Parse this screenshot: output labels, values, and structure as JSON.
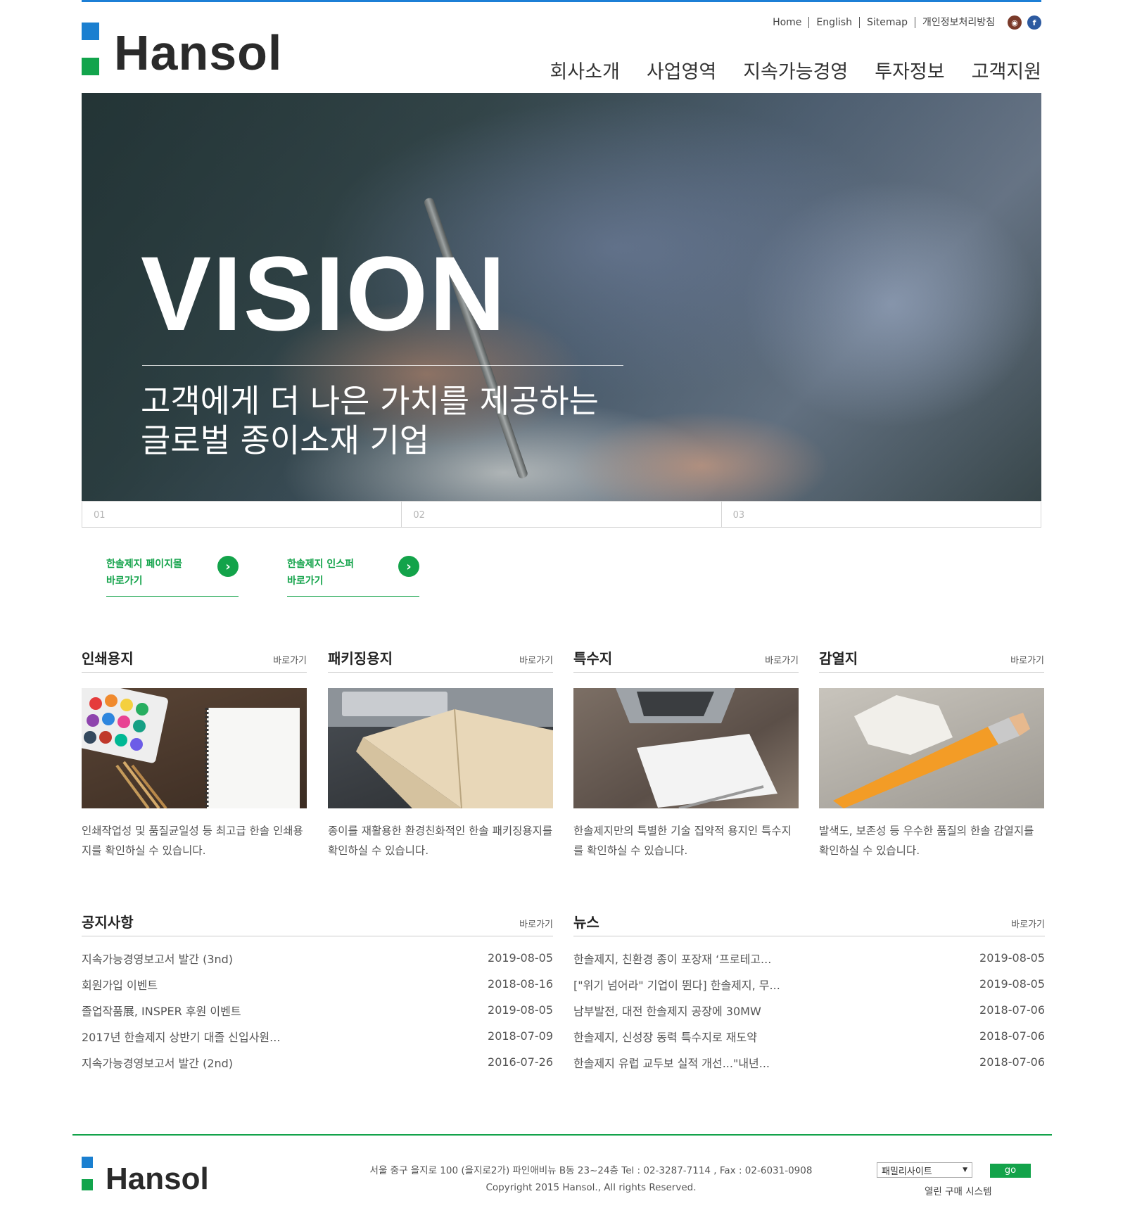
{
  "brand": {
    "logo_text": "Hansol"
  },
  "util_links": [
    "Home",
    "English",
    "Sitemap",
    "개인정보처리방침"
  ],
  "sns": [
    {
      "name": "instagram-icon",
      "glyph": "◉"
    },
    {
      "name": "facebook-icon",
      "glyph": "f"
    }
  ],
  "gnb": [
    "회사소개",
    "사업영역",
    "지속가능경영",
    "투자정보",
    "고객지원"
  ],
  "hero": {
    "title": "VISION",
    "subtitle": "고객에게 더 나은 가치를 제공하는\n글로벌 종이소재 기업"
  },
  "pager": [
    "01",
    "02",
    "03"
  ],
  "quick_links": [
    {
      "text": "한솔제지 페이지몰\n바로가기",
      "arrow": "›"
    },
    {
      "text": "한솔제지 인스퍼\n바로가기",
      "arrow": "›"
    }
  ],
  "products": [
    {
      "title": "인쇄용지",
      "more": "바로가기",
      "desc": "인쇄작업성 및 품질균일성 등 최고급 한솔 인쇄용지를 확인하실 수 있습니다."
    },
    {
      "title": "패키징용지",
      "more": "바로가기",
      "desc": "종이를 재활용한 환경친화적인 한솔 패키징용지를 확인하실 수 있습니다."
    },
    {
      "title": "특수지",
      "more": "바로가기",
      "desc": "한솔제지만의 특별한 기술 집약적 용지인 특수지를 확인하실 수 있습니다."
    },
    {
      "title": "감열지",
      "more": "바로가기",
      "desc": "발색도, 보존성 등 우수한 품질의 한솔 감열지를 확인하실 수 있습니다."
    }
  ],
  "notice": {
    "title": "공지사항",
    "more": "바로가기",
    "items": [
      {
        "title": "지속가능경영보고서 발간 (3nd)",
        "date": "2019-08-05"
      },
      {
        "title": "회원가입 이벤트",
        "date": "2018-08-16"
      },
      {
        "title": "졸업작품展, INSPER 후원 이벤트",
        "date": "2019-08-05"
      },
      {
        "title": "2017년 한솔제지 상반기 대졸 신입사원...",
        "date": "2018-07-09"
      },
      {
        "title": "지속가능경영보고서 발간 (2nd)",
        "date": "2016-07-26"
      }
    ]
  },
  "news": {
    "title": "뉴스",
    "more": "바로가기",
    "items": [
      {
        "title": "한솔제지, 친환경 종이 포장재 ‘프로테고...",
        "date": "2019-08-05"
      },
      {
        "title": "[\"위기 넘어라\" 기업이 뛴다] 한솔제지, 무...",
        "date": "2019-08-05"
      },
      {
        "title": "남부발전, 대전 한솔제지 공장에 30MW",
        "date": "2018-07-06"
      },
      {
        "title": "한솔제지, 신성장 동력 특수지로 재도약",
        "date": "2018-07-06"
      },
      {
        "title": "한솔제지 유럽 교두보 실적 개선...\"내년...",
        "date": "2018-07-06"
      }
    ]
  },
  "footer": {
    "logo_text": "Hansol",
    "address": "서울 중구 을지로 100 (을지로2가) 파인애비뉴 B동 23~24층 Tel : 02-3287-7114 , Fax : 02-6031-0908",
    "copyright": "Copyright 2015 Hansol., All rights Reserved.",
    "family_select": "패밀리사이트",
    "go_label": "go",
    "open_buy": "열린 구매 시스템"
  },
  "colors": {
    "accent_blue": "#1a7fd0",
    "accent_green": "#13a34a"
  }
}
